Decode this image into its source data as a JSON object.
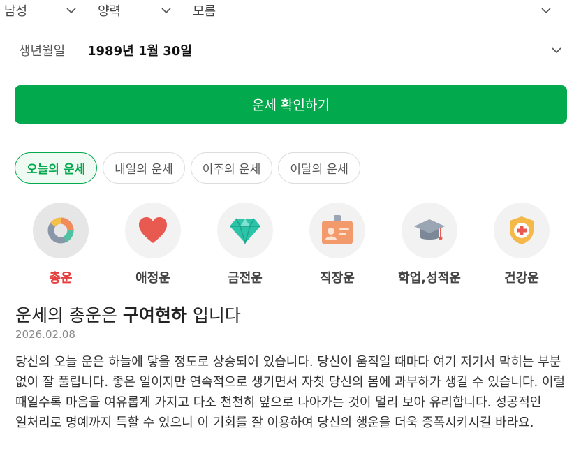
{
  "selectors": {
    "gender": "남성",
    "calendar": "양력",
    "birth_time": "모름"
  },
  "birthdate": {
    "label": "생년월일",
    "value": "1989년 1월 30일"
  },
  "cta_label": "운세 확인하기",
  "tabs": [
    {
      "label": "오늘의 운세",
      "active": true
    },
    {
      "label": "내일의 운세",
      "active": false
    },
    {
      "label": "이주의 운세",
      "active": false
    },
    {
      "label": "이달의 운세",
      "active": false
    }
  ],
  "categories": [
    {
      "label": "총운",
      "icon": "donut-chart-icon",
      "active": true
    },
    {
      "label": "애정운",
      "icon": "heart-icon",
      "active": false
    },
    {
      "label": "금전운",
      "icon": "diamond-icon",
      "active": false
    },
    {
      "label": "직장운",
      "icon": "id-badge-icon",
      "active": false
    },
    {
      "label": "학업,성적운",
      "icon": "graduation-cap-icon",
      "active": false
    },
    {
      "label": "건강운",
      "icon": "health-shield-icon",
      "active": false
    }
  ],
  "result": {
    "headline_prefix": "운세의 총운은",
    "headline_keyword": "구여현하",
    "headline_suffix": "입니다",
    "date": "2026.02.08",
    "body": "당신의 오늘 운은 하늘에 닿을 정도로 상승되어 있습니다. 당신이 움직일 때마다 여기 저기서 막히는 부분 없이 잘 풀립니다. 좋은 일이지만 연속적으로 생기면서 자칫 당신의 몸에 과부하가 생길 수 있습니다. 이럴 때일수록 마음을 여유롭게 가지고 다소 천천히 앞으로 나아가는 것이 멀리 보아 유리합니다. 성공적인 일처리로 명예까지 득할 수 있으니 이 기회를 잘 이용하여 당신의 행운을 더욱 증폭시키시길 바라요."
  },
  "colors": {
    "accent_green": "#03a94d",
    "active_category": "#e63e3e"
  }
}
